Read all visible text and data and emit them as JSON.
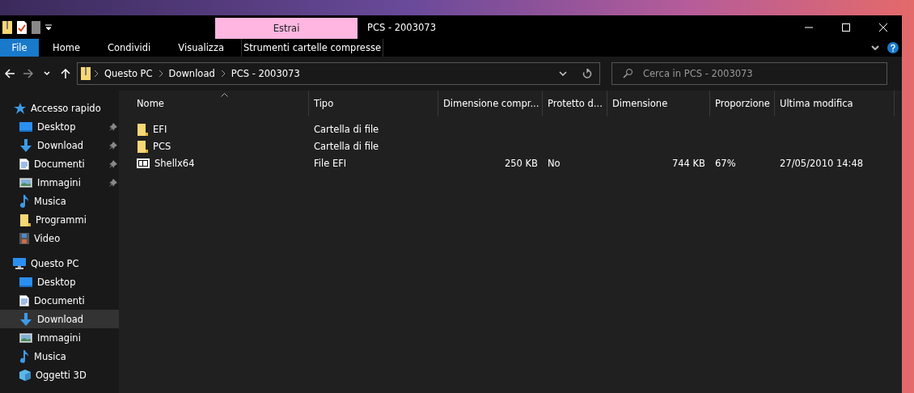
{
  "window": {
    "title": "PCS - 2003073",
    "context_group": "Estrai"
  },
  "ribbon_tabs": [
    {
      "label": "File",
      "kind": "file"
    },
    {
      "label": "Home",
      "kind": "tab"
    },
    {
      "label": "Condividi",
      "kind": "tab"
    },
    {
      "label": "Visualizza",
      "kind": "tab"
    },
    {
      "label": "Strumenti cartelle compresse",
      "kind": "context"
    }
  ],
  "address": {
    "crumbs": [
      "Questo PC",
      "Download",
      "PCS - 2003073"
    ]
  },
  "search": {
    "placeholder": "Cerca in PCS - 2003073"
  },
  "sidebar": {
    "items": [
      {
        "label": "Accesso rapido",
        "kind": "star",
        "selected": false,
        "children": [
          {
            "label": "Desktop",
            "kind": "desktop",
            "pinned": true,
            "selected": false
          },
          {
            "label": "Download",
            "kind": "download",
            "pinned": true,
            "selected": false
          },
          {
            "label": "Documenti",
            "kind": "document",
            "pinned": true,
            "selected": false
          },
          {
            "label": "Immagini",
            "kind": "picture",
            "pinned": true,
            "selected": false
          },
          {
            "label": "Musica",
            "kind": "music",
            "pinned": false,
            "selected": false
          },
          {
            "label": "Programmi",
            "kind": "folder",
            "pinned": false,
            "selected": false
          },
          {
            "label": "Video",
            "kind": "video",
            "pinned": false,
            "selected": false
          }
        ]
      },
      {
        "label": "Questo PC",
        "kind": "pc",
        "selected": false,
        "children": [
          {
            "label": "Desktop",
            "kind": "desktop",
            "pinned": false,
            "selected": false
          },
          {
            "label": "Documenti",
            "kind": "document",
            "pinned": false,
            "selected": false
          },
          {
            "label": "Download",
            "kind": "download",
            "pinned": false,
            "selected": true
          },
          {
            "label": "Immagini",
            "kind": "picture",
            "pinned": false,
            "selected": false
          },
          {
            "label": "Musica",
            "kind": "music",
            "pinned": false,
            "selected": false
          },
          {
            "label": "Oggetti 3D",
            "kind": "cube",
            "pinned": false,
            "selected": false
          }
        ]
      }
    ]
  },
  "table": {
    "columns": [
      "Nome",
      "Tipo",
      "Dimensione compr...",
      "Protetto d...",
      "Dimensione",
      "Proporzione",
      "Ultima modifica"
    ],
    "rows": [
      {
        "kind": "folder",
        "cells": [
          "EFI",
          "Cartella di file",
          "",
          "",
          "",
          "",
          ""
        ]
      },
      {
        "kind": "folder",
        "cells": [
          "PCS",
          "Cartella di file",
          "",
          "",
          "",
          "",
          ""
        ]
      },
      {
        "kind": "archive",
        "cells": [
          "Shellx64",
          "File EFI",
          "250 KB",
          "No",
          "744 KB",
          "67%",
          "27/05/2010 14:48"
        ]
      }
    ]
  }
}
